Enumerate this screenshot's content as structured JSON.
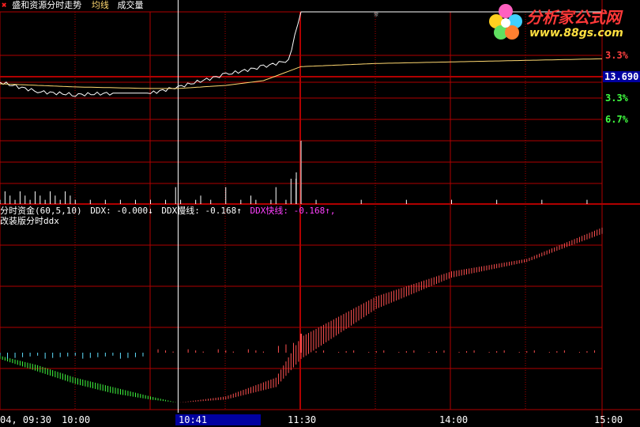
{
  "header": {
    "close_glyph": "✖",
    "title": "盛和资源分时走势",
    "avg_label": "均线",
    "vol_label": "成交量"
  },
  "logo": {
    "brand": "分析家公式网",
    "url": "www.88gs.com"
  },
  "indicator": {
    "name": "分时资金(60,5,10)",
    "ddx": "DDX: -0.000↓",
    "ddx_slow": "DDX慢线: -0.168↑",
    "ddx_fast": "DDX快线: -0.168↑,",
    "subtitle": "改装版分时ddx"
  },
  "y_labels": {
    "up1": "3.3%",
    "price": "13.690",
    "down1": "3.3%",
    "down2": "6.7%"
  },
  "x_labels": [
    "04, 09:30",
    "10:00",
    "10:41",
    "11:30",
    "14:00",
    "15:00"
  ],
  "colors": {
    "grid": "#b00000",
    "price": "#ffffff",
    "avg": "#ffd870",
    "vol": "#ffffff",
    "red": "#ff4040",
    "green": "#40ff40",
    "ddx_up": "#ff5050",
    "ddx_down": "#60e0ff",
    "ddx_text": "#ffffff",
    "fast_text": "#ff40ff",
    "cursor_bg": "#0000a0"
  },
  "chart_data": [
    {
      "type": "line",
      "title": "盛和资源分时走势",
      "series": [
        {
          "name": "分时",
          "x": [
            "09:30",
            "09:45",
            "10:00",
            "10:15",
            "10:30",
            "10:41",
            "11:00",
            "11:15",
            "11:25",
            "11:30",
            "13:30",
            "14:00",
            "14:30",
            "15:00"
          ],
          "values": [
            13.69,
            13.63,
            13.61,
            13.62,
            13.62,
            13.66,
            13.74,
            13.79,
            13.83,
            14.14,
            14.14,
            14.14,
            14.14,
            14.14
          ]
        },
        {
          "name": "均线",
          "x": [
            "09:30",
            "10:00",
            "10:30",
            "10:41",
            "11:00",
            "11:15",
            "11:30",
            "13:30",
            "14:00",
            "14:30",
            "15:00"
          ],
          "values": [
            13.68,
            13.66,
            13.65,
            13.65,
            13.67,
            13.7,
            13.79,
            13.81,
            13.82,
            13.83,
            13.84
          ]
        }
      ],
      "reference_price": 13.69
    },
    {
      "type": "bar",
      "title": "成交量",
      "notes": "volume spike at 11:30",
      "x": [
        "09:30",
        "10:00",
        "10:41",
        "11:00",
        "11:20",
        "11:30",
        "13:30",
        "14:00",
        "14:30",
        "15:00"
      ],
      "values": [
        2,
        1,
        2,
        3,
        4,
        10,
        1,
        1,
        1,
        1
      ]
    },
    {
      "type": "area",
      "title": "改装版分时ddx",
      "series": [
        {
          "name": "DDX快线",
          "x": [
            "09:30",
            "09:45",
            "10:00",
            "10:15",
            "10:30",
            "10:41",
            "11:00",
            "11:20",
            "11:30",
            "13:30",
            "14:00",
            "14:30",
            "15:00"
          ],
          "values": [
            -0.02,
            -0.06,
            -0.1,
            -0.13,
            -0.15,
            -0.16,
            -0.14,
            -0.08,
            0.05,
            0.18,
            0.26,
            0.3,
            0.4
          ]
        },
        {
          "name": "DDX慢线",
          "x": [
            "09:30",
            "09:45",
            "10:00",
            "10:15",
            "10:30",
            "10:41",
            "11:00",
            "11:20",
            "11:30",
            "13:30",
            "14:00",
            "14:30",
            "15:00"
          ],
          "values": [
            -0.01,
            -0.04,
            -0.08,
            -0.11,
            -0.14,
            -0.16,
            -0.15,
            -0.11,
            -0.02,
            0.14,
            0.24,
            0.29,
            0.38
          ]
        }
      ]
    }
  ]
}
